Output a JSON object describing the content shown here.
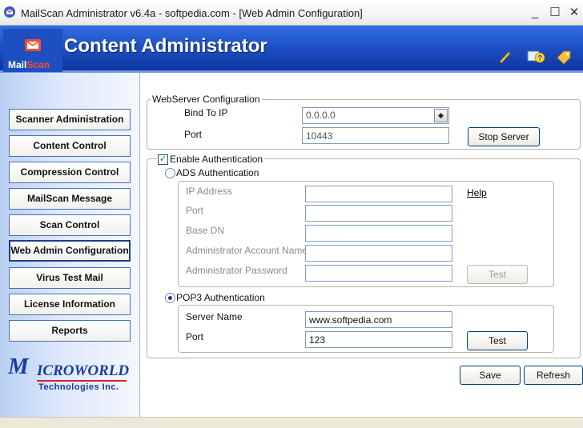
{
  "window": {
    "title": "MailScan Administrator v6.4a - softpedia.com - [Web Admin Configuration]",
    "min_glyph": "_",
    "max_glyph": "☐",
    "close_glyph": "✕"
  },
  "header": {
    "logo_mail": "Mail",
    "logo_scan": "Scan",
    "title": "Content Administrator",
    "tool_icons": [
      "pencil-icon",
      "help-icon",
      "tag-icon"
    ]
  },
  "sidebar": {
    "items": [
      {
        "label": "Scanner Administration",
        "active": false
      },
      {
        "label": "Content Control",
        "active": false
      },
      {
        "label": "Compression Control",
        "active": false
      },
      {
        "label": "MailScan Message",
        "active": false
      },
      {
        "label": "Scan Control",
        "active": false
      },
      {
        "label": "Web Admin Configuration",
        "active": true
      },
      {
        "label": "Virus Test Mail",
        "active": false
      },
      {
        "label": "License Information",
        "active": false
      },
      {
        "label": "Reports",
        "active": false
      }
    ],
    "brand": {
      "first_letter": "M",
      "rest": "ICROWORLD",
      "sub": "Technologies Inc."
    }
  },
  "webserver": {
    "group_label": "WebServer Configuration",
    "bind_label": "Bind To IP",
    "bind_value": "0.0.0.0",
    "port_label": "Port",
    "port_value": "10443",
    "stop_button": "Stop Server"
  },
  "auth": {
    "enable_label": "Enable Authentication",
    "enabled": true,
    "ads": {
      "label": "ADS Authentication",
      "selected": false,
      "ip_label": "IP Address",
      "ip_value": "",
      "port_label": "Port",
      "port_value": "",
      "basedn_label": "Base DN",
      "basedn_value": "",
      "admin_name_label": "Administrator Account Name",
      "admin_name_value": "",
      "admin_pass_label": "Administrator Password",
      "admin_pass_value": "",
      "help_link": "Help",
      "test_button": "Test"
    },
    "pop3": {
      "label": "POP3 Authentication",
      "selected": true,
      "server_label": "Server Name",
      "server_value": "www.softpedia.com",
      "port_label": "Port",
      "port_value": "123",
      "test_button": "Test"
    }
  },
  "footer": {
    "save_button": "Save",
    "refresh_button": "Refresh"
  },
  "colors": {
    "header_blue": "#1d4fc2",
    "nav_border": "#4a6fb0",
    "brand_blue": "#1a3d9c",
    "brand_red": "#d42020"
  }
}
